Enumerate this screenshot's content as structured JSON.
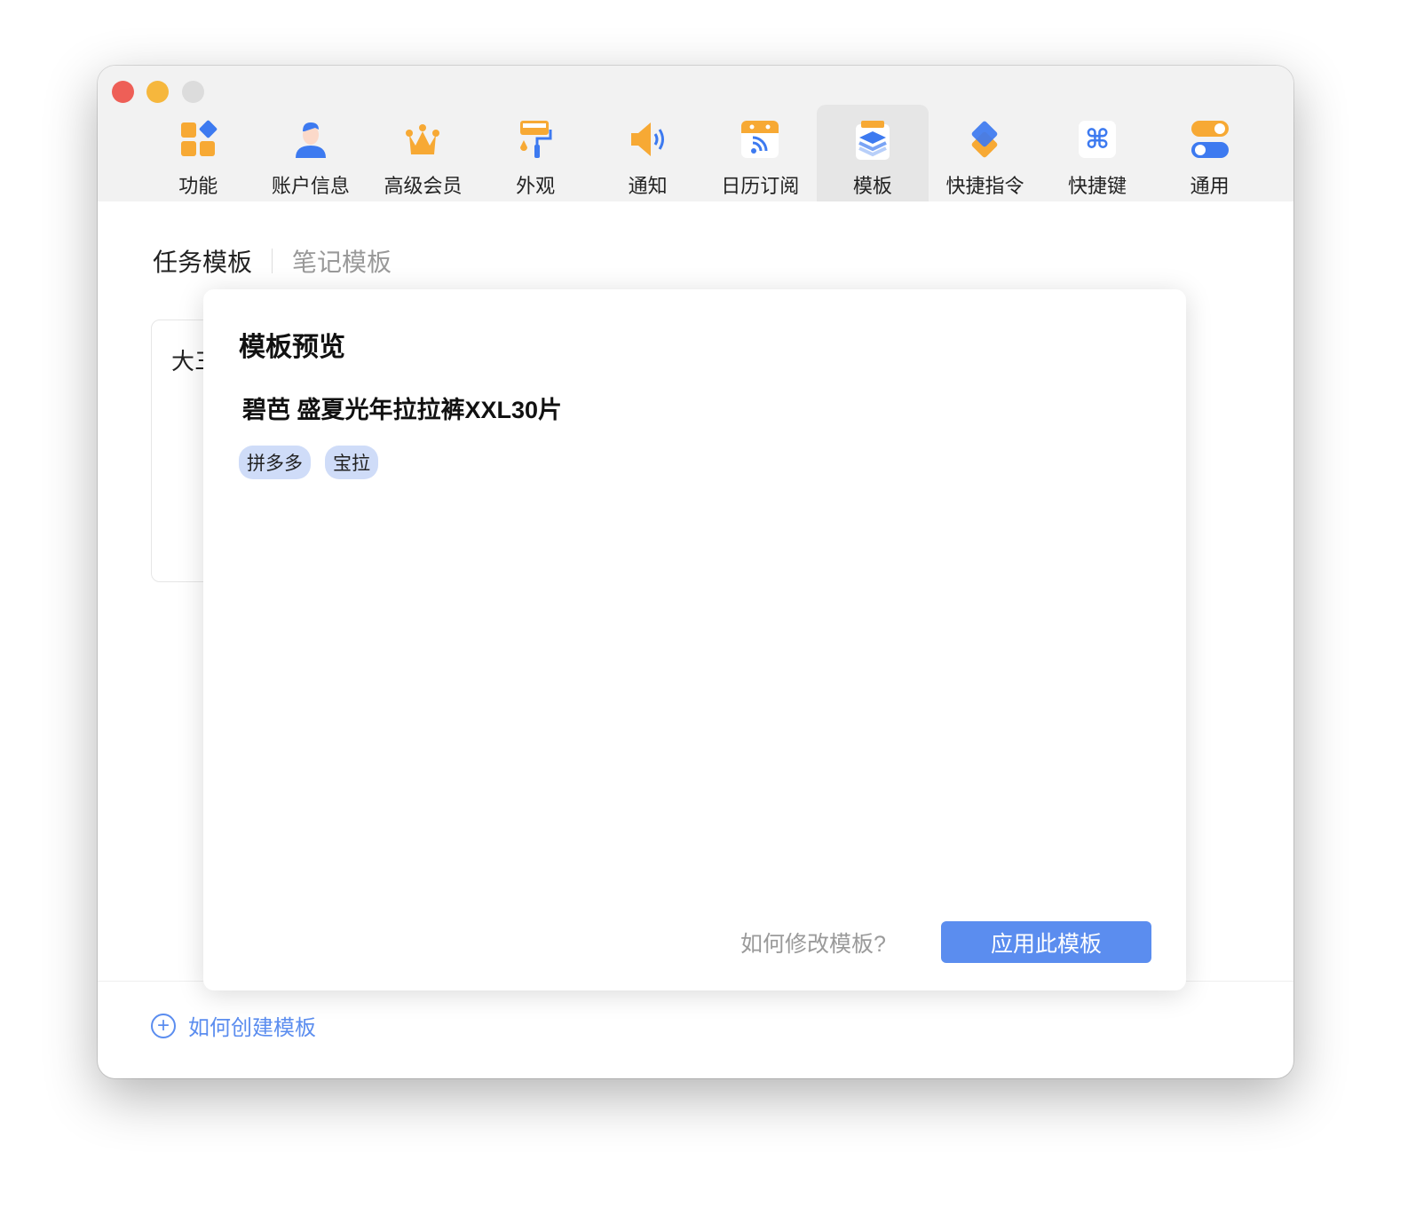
{
  "toolbar": {
    "items": [
      {
        "label": "功能",
        "icon": "features-icon"
      },
      {
        "label": "账户信息",
        "icon": "account-icon"
      },
      {
        "label": "高级会员",
        "icon": "crown-icon"
      },
      {
        "label": "外观",
        "icon": "paint-roller-icon"
      },
      {
        "label": "通知",
        "icon": "speaker-icon"
      },
      {
        "label": "日历订阅",
        "icon": "calendar-rss-icon"
      },
      {
        "label": "模板",
        "icon": "template-clipboard-icon",
        "active": true
      },
      {
        "label": "快捷指令",
        "icon": "shortcuts-icon"
      },
      {
        "label": "快捷键",
        "icon": "command-key-icon"
      },
      {
        "label": "通用",
        "icon": "toggle-icon"
      }
    ]
  },
  "tabs": {
    "task": "任务模板",
    "note": "笔记模板"
  },
  "background_card": {
    "title": "大三"
  },
  "modal": {
    "title": "模板预览",
    "item": "碧芭 盛夏光年拉拉裤XXL30片",
    "tags": [
      "拼多多",
      "宝拉"
    ],
    "help": "如何修改模板?",
    "apply": "应用此模板"
  },
  "footer": {
    "create": "如何创建模板"
  },
  "colors": {
    "accent": "#5b8def",
    "orange": "#f7a934",
    "tag_bg": "#cfdcf8"
  }
}
